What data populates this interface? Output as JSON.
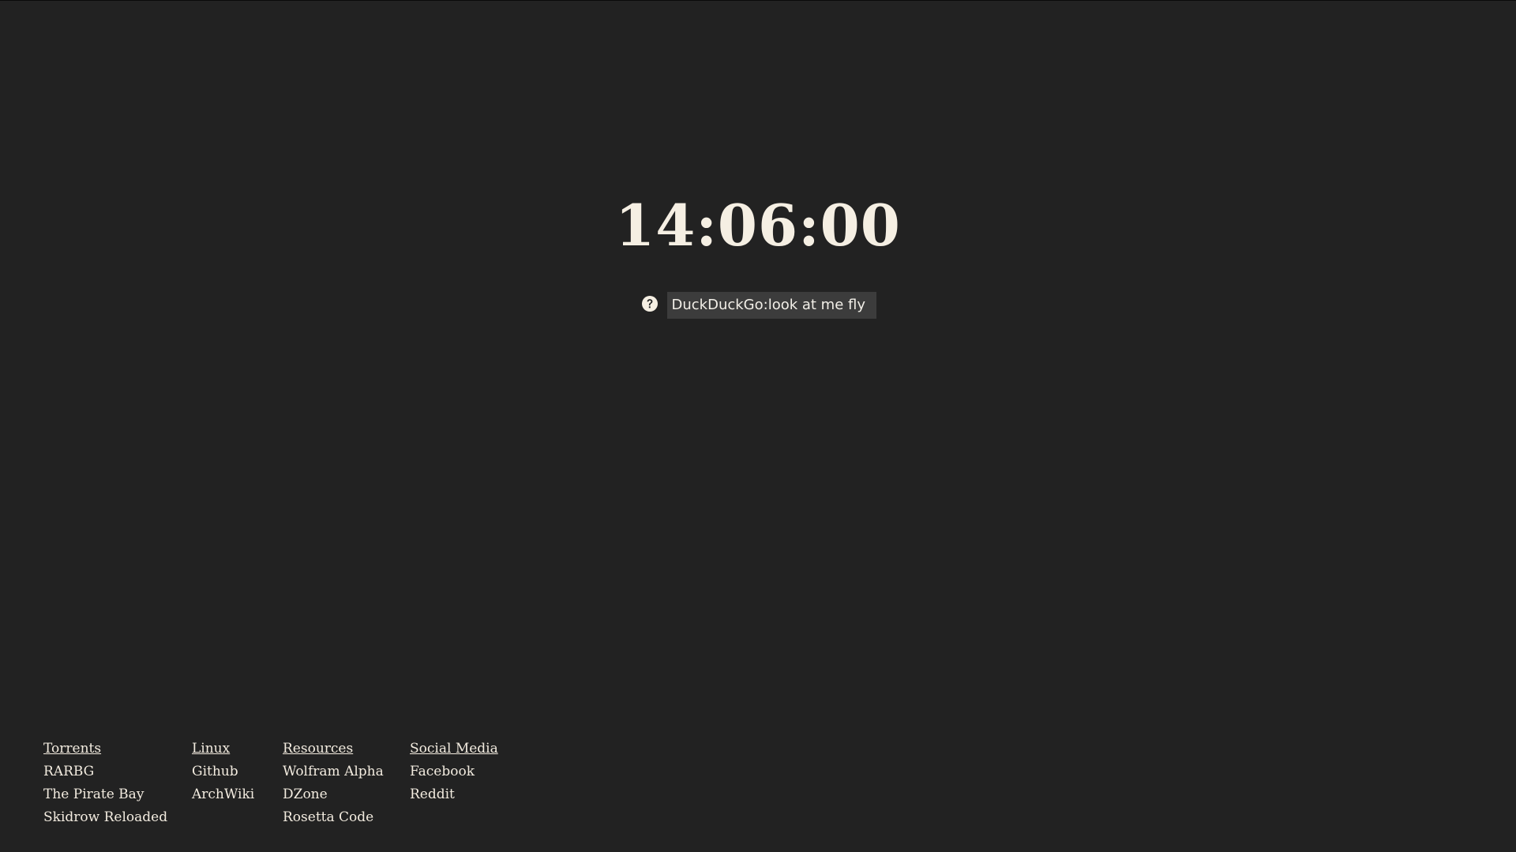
{
  "clock": {
    "time": "14:06:00"
  },
  "search": {
    "icon": "question-circle-icon",
    "value": "DuckDuckGo:look at me fly"
  },
  "links": {
    "torrents": {
      "heading": "Torrents",
      "items": [
        "RARBG",
        "The Pirate Bay",
        "Skidrow Reloaded"
      ]
    },
    "linux": {
      "heading": "Linux",
      "items": [
        "Github",
        "ArchWiki"
      ]
    },
    "resources": {
      "heading": "Resources",
      "items": [
        "Wolfram Alpha",
        "DZone",
        "Rosetta Code"
      ]
    },
    "social": {
      "heading": "Social Media",
      "items": [
        "Facebook",
        "Reddit"
      ]
    }
  },
  "colors": {
    "background": "#222222",
    "text": "#f3ece0",
    "search_bg": "#3c3c3c"
  }
}
